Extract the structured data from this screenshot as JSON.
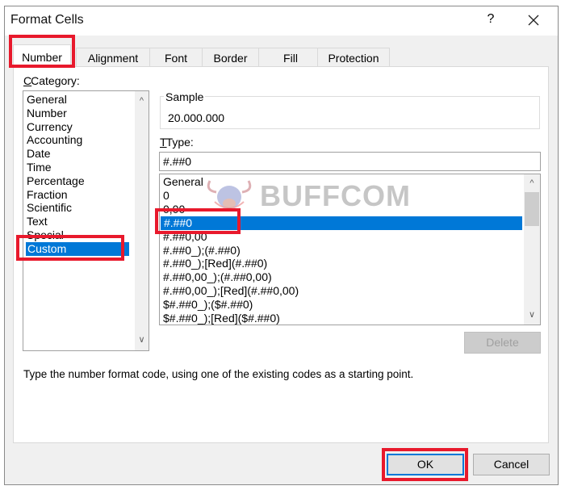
{
  "window": {
    "title": "Format Cells",
    "help_label": "?",
    "close_icon": "close-icon"
  },
  "tabs": [
    {
      "label": "Number",
      "active": true
    },
    {
      "label": "Alignment",
      "active": false
    },
    {
      "label": "Font",
      "active": false
    },
    {
      "label": "Border",
      "active": false
    },
    {
      "label": "Fill",
      "active": false
    },
    {
      "label": "Protection",
      "active": false
    }
  ],
  "category": {
    "label": "Category:",
    "items": [
      "General",
      "Number",
      "Currency",
      "Accounting",
      "Date",
      "Time",
      "Percentage",
      "Fraction",
      "Scientific",
      "Text",
      "Special",
      "Custom"
    ],
    "selected": "Custom"
  },
  "sample": {
    "label": "Sample",
    "value": "20.000.000"
  },
  "type": {
    "label": "Type:",
    "value": "#.##0",
    "items": [
      "General",
      "0",
      "0,00",
      "#.##0",
      "#.##0,00",
      "#.##0_);(#.##0)",
      "#.##0_);[Red](#.##0)",
      "#.##0,00_);(#.##0,00)",
      "#.##0,00_);[Red](#.##0,00)",
      "$#.##0_);($#.##0)",
      "$#.##0_);[Red]($#.##0)"
    ],
    "selected": "#.##0"
  },
  "buttons": {
    "delete": "Delete",
    "ok": "OK",
    "cancel": "Cancel"
  },
  "hint": "Type the number format code, using one of the existing codes as a starting point.",
  "watermark": "BUFFCOM",
  "colors": {
    "selection": "#0078d7",
    "highlight": "#e8192c"
  }
}
